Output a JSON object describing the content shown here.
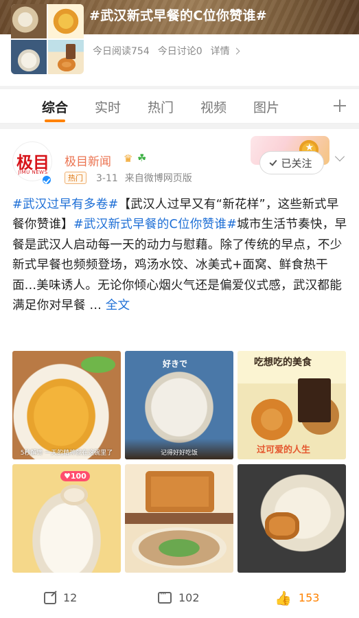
{
  "topic": {
    "title": "#武汉新式早餐的C位你赞谁#",
    "read_today": "今日阅读754",
    "discuss_today": "今日讨论0",
    "details_label": "详情"
  },
  "tabs": [
    "综合",
    "实时",
    "热门",
    "视频",
    "图片"
  ],
  "post": {
    "avatar_logo": "极目",
    "avatar_sub": "JIMU NEWS",
    "author": "极目新闻",
    "hot_badge": "热门",
    "date": "3-11",
    "source": "来自微博网页版",
    "follow_label": "已关注",
    "text": {
      "tag1": "#武汉过早有多卷#",
      "part1": "【武汉人过早又有“新花样”，这些新式早餐你赞谁】",
      "tag2": "#武汉新式早餐的C位你赞谁#",
      "part2": "城市生活节奏快，早餐是武汉人启动每一天的动力与慰藉。除了传统的早点，不少新式早餐也频频登场，鸡汤水饺、冰美式+面窝、鲜食热干面...美味诱人。无论你倾心烟火气还是偏爱仪式感，武汉都能满足你对早餐 ... ",
      "full_text_link": "全文"
    },
    "photos": {
      "p1_caption": "5秒解馋 一天的精神就在这碗里了",
      "p2_label": "好きで",
      "p2_caption": "记得好好吃饭",
      "p3_label": "吃想吃的美食",
      "p3_label2": "过可爱的人生",
      "p4_badge": "♥100"
    },
    "actions": {
      "share_count": "12",
      "comment_count": "102",
      "like_count": "153"
    }
  },
  "colors": {
    "accent_orange": "#ff8200",
    "link_blue": "#1e6fd6",
    "author_orange": "#eb7350"
  }
}
